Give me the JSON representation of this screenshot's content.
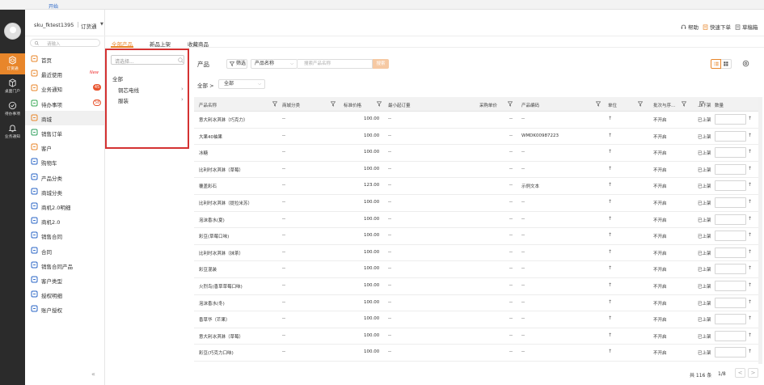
{
  "browser": {
    "start_tab": "开始"
  },
  "rail": {
    "items": [
      {
        "label": "订货通",
        "icon": "cube-icon"
      },
      {
        "label": "桌面门户",
        "icon": "box-icon"
      },
      {
        "label": "待办事项",
        "icon": "check-circle-icon"
      },
      {
        "label": "业务通知",
        "icon": "bell-icon"
      }
    ]
  },
  "sidebar": {
    "search_placeholder": "请输入",
    "items": [
      {
        "label": "首页",
        "icon": "home-icon",
        "color": "#e8862a"
      },
      {
        "label": "最近使用",
        "icon": "recent-icon",
        "color": "#e8862a",
        "new": "New"
      },
      {
        "label": "业务通知",
        "icon": "bell-icon",
        "color": "#e8862a",
        "badge": "45"
      },
      {
        "label": "待办事项",
        "icon": "check-circle-icon",
        "color": "#35a853",
        "badge": "58"
      },
      {
        "label": "商城",
        "icon": "mall-icon",
        "color": "#e8862a",
        "active": true
      },
      {
        "label": "销售订单",
        "icon": "order-icon",
        "color": "#2a9d5a"
      },
      {
        "label": "客户",
        "icon": "customer-icon",
        "color": "#e8862a"
      },
      {
        "label": "购物车",
        "icon": "cart-icon",
        "color": "#2a66c6"
      },
      {
        "label": "产品分类",
        "icon": "category-icon",
        "color": "#2a66c6"
      },
      {
        "label": "商城分类",
        "icon": "chart-icon",
        "color": "#2a66c6"
      },
      {
        "label": "商机2.0明细",
        "icon": "chart-icon",
        "color": "#2a66c6"
      },
      {
        "label": "商机2.0",
        "icon": "target-icon",
        "color": "#2a66c6"
      },
      {
        "label": "销售合同",
        "icon": "contract-icon",
        "color": "#2a66c6"
      },
      {
        "label": "合同",
        "icon": "contract-icon",
        "color": "#2a66c6"
      },
      {
        "label": "销售合同产品",
        "icon": "contract-icon",
        "color": "#2a66c6"
      },
      {
        "label": "客户类型",
        "icon": "customer-type-icon",
        "color": "#2a66c6"
      },
      {
        "label": "授权明细",
        "icon": "auth-icon",
        "color": "#2a66c6"
      },
      {
        "label": "账户授权",
        "icon": "account-icon",
        "color": "#2a66c6"
      }
    ],
    "collapse": "«"
  },
  "header": {
    "user": "sku_fktest1395",
    "shop": "订货通",
    "help": "帮助",
    "quick_order": "快速下单",
    "drafts": "草稿箱"
  },
  "tabs": [
    "全部产品",
    "新品上架",
    "收藏商品"
  ],
  "category_panel": {
    "search_placeholder": "请选择...",
    "all": "全部",
    "items": [
      "铜芯电线",
      "服装"
    ]
  },
  "toolbar": {
    "label": "产品",
    "filter": "筛选",
    "field": "产品名称",
    "search_placeholder": "搜索产品名称",
    "search_btn": "搜索"
  },
  "breadcrumb": {
    "root": "全部",
    "sep": ">",
    "select": "全部"
  },
  "table": {
    "columns": [
      "产品名称",
      "商城分类",
      "标准价格",
      "最小起订量",
      "采购单价",
      "产品编码",
      "单位",
      "批次与序...",
      "上下架",
      "数量"
    ],
    "rows": [
      {
        "name": "意大利冰淇淋（巧克力）",
        "cat": "--",
        "price": "100.00",
        "moq": "--",
        "unit_price": "--",
        "code": "--",
        "status": "不开启",
        "shelf": "已上架"
      },
      {
        "name": "大果40袖果",
        "cat": "--",
        "price": "100.00",
        "moq": "--",
        "unit_price": "--",
        "code": "WMDK00987223",
        "status": "不开启",
        "shelf": "已上架"
      },
      {
        "name": "冰糖",
        "cat": "--",
        "price": "100.00",
        "moq": "--",
        "unit_price": "--",
        "code": "--",
        "status": "不开启",
        "shelf": "已上架"
      },
      {
        "name": "比利时冰淇淋（草莓）",
        "cat": "--",
        "price": "100.00",
        "moq": "--",
        "unit_price": "--",
        "code": "--",
        "status": "不开启",
        "shelf": "已上架"
      },
      {
        "name": "覆盖彩石",
        "cat": "--",
        "price": "123.00",
        "moq": "--",
        "unit_price": "--",
        "code": "示例文本",
        "status": "不开启",
        "shelf": "已上架"
      },
      {
        "name": "比利时冰淇淋（提拉米苏）",
        "cat": "--",
        "price": "100.00",
        "moq": "--",
        "unit_price": "--",
        "code": "--",
        "status": "不开启",
        "shelf": "已上架"
      },
      {
        "name": "泡沫香水(夏)",
        "cat": "--",
        "price": "100.00",
        "moq": "--",
        "unit_price": "--",
        "code": "--",
        "status": "不开启",
        "shelf": "已上架"
      },
      {
        "name": "彩豆(草莓口味)",
        "cat": "--",
        "price": "100.00",
        "moq": "--",
        "unit_price": "--",
        "code": "--",
        "status": "不开启",
        "shelf": "已上架"
      },
      {
        "name": "比利时冰淇淋（抹茶）",
        "cat": "--",
        "price": "100.00",
        "moq": "--",
        "unit_price": "--",
        "code": "--",
        "status": "不开启",
        "shelf": "已上架"
      },
      {
        "name": "彩豆混装",
        "cat": "--",
        "price": "100.00",
        "moq": "--",
        "unit_price": "--",
        "code": "--",
        "status": "不开启",
        "shelf": "已上架"
      },
      {
        "name": "火烈鸟(香草草莓口味)",
        "cat": "--",
        "price": "100.00",
        "moq": "--",
        "unit_price": "--",
        "code": "--",
        "status": "不开启",
        "shelf": "已上架"
      },
      {
        "name": "泡沫香水(冬)",
        "cat": "--",
        "price": "100.00",
        "moq": "--",
        "unit_price": "--",
        "code": "--",
        "status": "不开启",
        "shelf": "已上架"
      },
      {
        "name": "香草华（芒果）",
        "cat": "--",
        "price": "100.00",
        "moq": "--",
        "unit_price": "--",
        "code": "--",
        "status": "不开启",
        "shelf": "已上架"
      },
      {
        "name": "意大利冰淇淋（草莓）",
        "cat": "--",
        "price": "100.00",
        "moq": "--",
        "unit_price": "--",
        "code": "--",
        "status": "不开启",
        "shelf": "已上架"
      },
      {
        "name": "彩豆(巧克力口味)",
        "cat": "--",
        "price": "100.00",
        "moq": "--",
        "unit_price": "--",
        "code": "--",
        "status": "不开启",
        "shelf": "已上架"
      }
    ]
  },
  "footer": {
    "total": "共 116 条",
    "page": "1/8",
    "prev": "<",
    "next": ">"
  },
  "colors": {
    "accent": "#e8862a",
    "highlight_border": "#d43232",
    "rail_bg": "#2b2b2b"
  }
}
